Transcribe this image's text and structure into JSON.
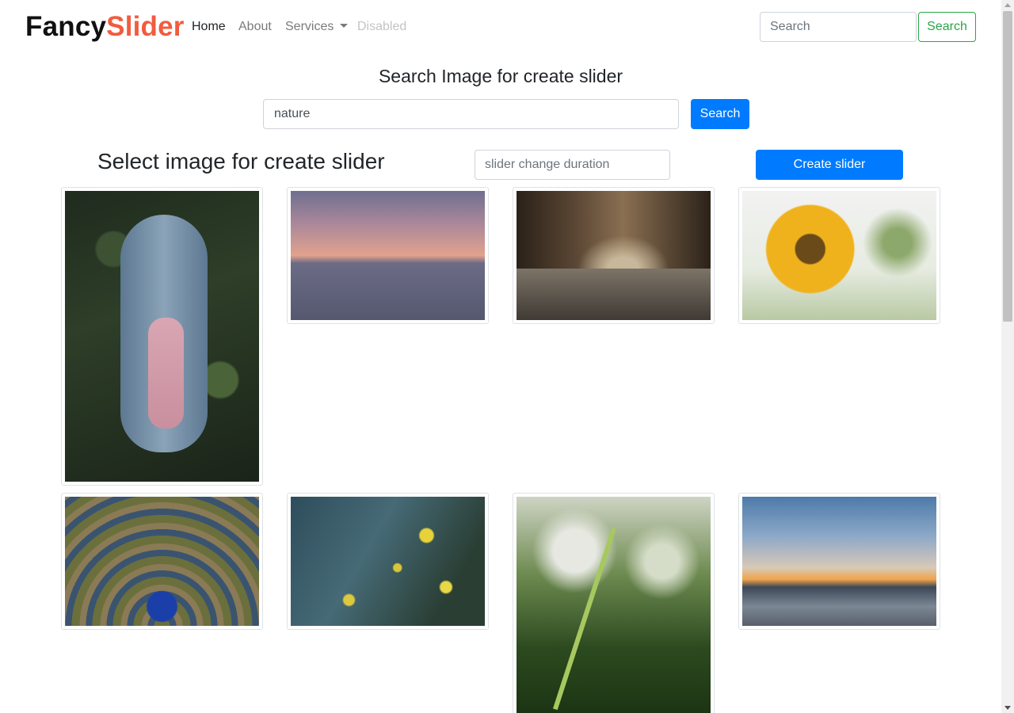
{
  "brand": {
    "part1": "Fancy",
    "part2": "Slider"
  },
  "nav": {
    "links": [
      {
        "label": "Home"
      },
      {
        "label": "About"
      },
      {
        "label": "Services"
      },
      {
        "label": "Disabled"
      }
    ],
    "search_placeholder": "Search",
    "search_button": "Search"
  },
  "search_section": {
    "title": "Search Image for create slider",
    "input_value": "nature",
    "button": "Search"
  },
  "slider_section": {
    "title": "Select image for create slider",
    "duration_placeholder": "slider change duration",
    "create_button": "Create slider"
  },
  "gallery": {
    "images": [
      {
        "subject": "girl lying in rowboat among lily pads"
      },
      {
        "subject": "pink sunset over calm sea"
      },
      {
        "subject": "stone cloister arched corridor"
      },
      {
        "subject": "sunflower"
      },
      {
        "subject": "peacock displaying feathers"
      },
      {
        "subject": "yellow wildflowers"
      },
      {
        "subject": "green sprout against blurred background"
      },
      {
        "subject": "sunset sky over lake shore"
      }
    ]
  },
  "colors": {
    "brand_accent": "#f15c3f",
    "primary": "#007bff",
    "success": "#28a745"
  }
}
